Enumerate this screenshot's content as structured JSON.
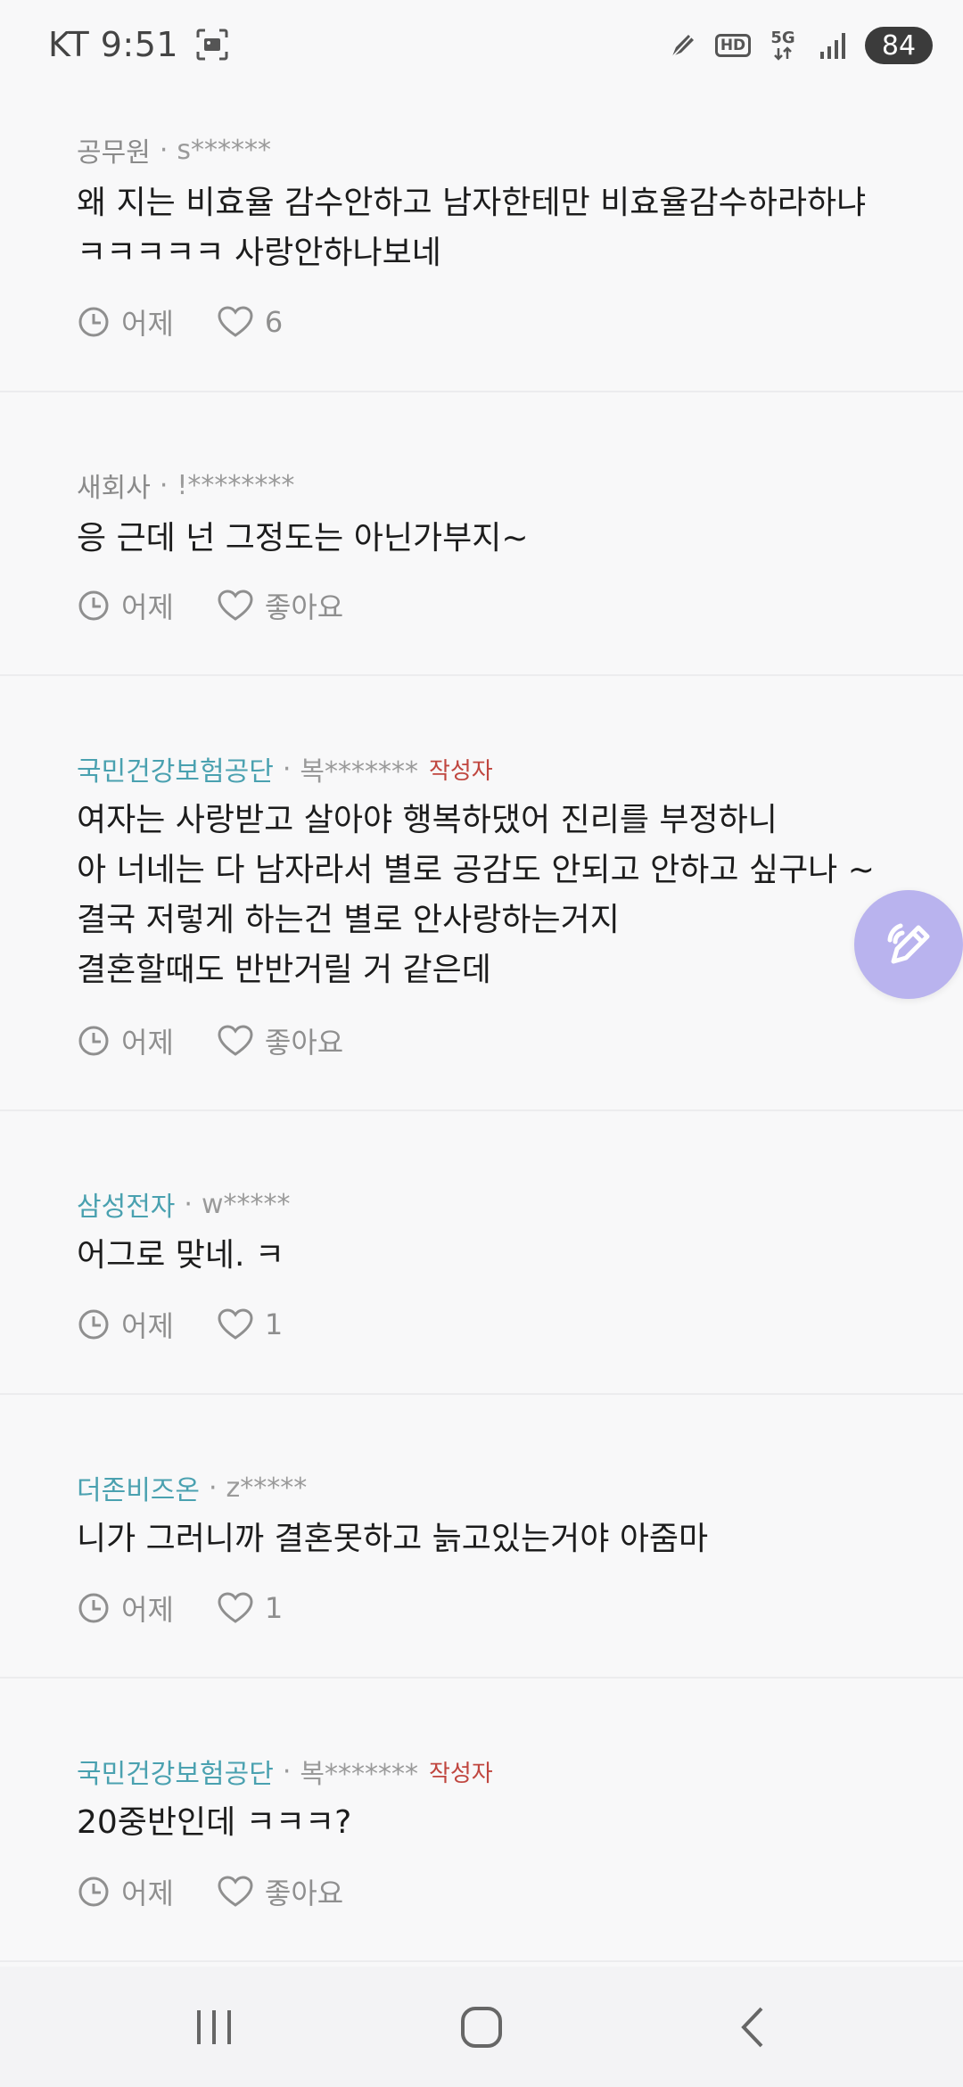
{
  "status_bar": {
    "carrier_time": "KT 9:51",
    "hd_label": "HD",
    "network_label": "5G",
    "battery": "84",
    "icons": [
      "screenshot-icon",
      "pen-icon",
      "hd-icon",
      "5g-icon",
      "signal-icon",
      "battery-icon"
    ]
  },
  "comments": [
    {
      "company": "공무원",
      "sep": "·",
      "user": "s******",
      "author_badge": "",
      "lines": [
        "왜 지는 비효율 감수안하고 남자한테만 비효율감수하라하냐",
        "ㅋㅋㅋㅋㅋ 사랑안하나보네"
      ],
      "time": "어제",
      "likes": "6"
    },
    {
      "company": "새회사",
      "sep": "·",
      "user": "!********",
      "author_badge": "",
      "lines": [
        "응 근데 넌 그정도는 아닌가부지~"
      ],
      "time": "어제",
      "likes": "좋아요"
    },
    {
      "company": "국민건강보험공단",
      "sep": "·",
      "user": "복*******",
      "author_badge": "작성자",
      "lines": [
        "여자는 사랑받고 살아야 행복하댔어 진리를 부정하니",
        "아 너네는 다 남자라서 별로 공감도 안되고 안하고 싶구나 ~",
        "결국 저렇게 하는건 별로 안사랑하는거지",
        "결혼할때도 반반거릴 거 같은데"
      ],
      "time": "어제",
      "likes": "좋아요"
    },
    {
      "company": "삼성전자",
      "sep": "·",
      "user": "w*****",
      "author_badge": "",
      "lines": [
        "어그로 맞네. ㅋ"
      ],
      "time": "어제",
      "likes": "1"
    },
    {
      "company": "더존비즈온",
      "sep": "·",
      "user": "z*****",
      "author_badge": "",
      "lines": [
        "니가 그러니까 결혼못하고 늙고있는거야 아줌마"
      ],
      "time": "어제",
      "likes": "1"
    },
    {
      "company": "국민건강보험공단",
      "sep": "·",
      "user": "복*******",
      "author_badge": "작성자",
      "lines": [
        "20중반인데 ㅋㅋㅋ?"
      ],
      "time": "어제",
      "likes": "좋아요"
    }
  ],
  "colors": {
    "company_accent": "#4aa1b0",
    "author_badge": "#c0463f",
    "fab": "#b9b3ee"
  },
  "fab": {
    "icon": "write-icon"
  },
  "nav": {
    "icons": [
      "recent-apps-icon",
      "home-icon",
      "back-icon"
    ]
  }
}
